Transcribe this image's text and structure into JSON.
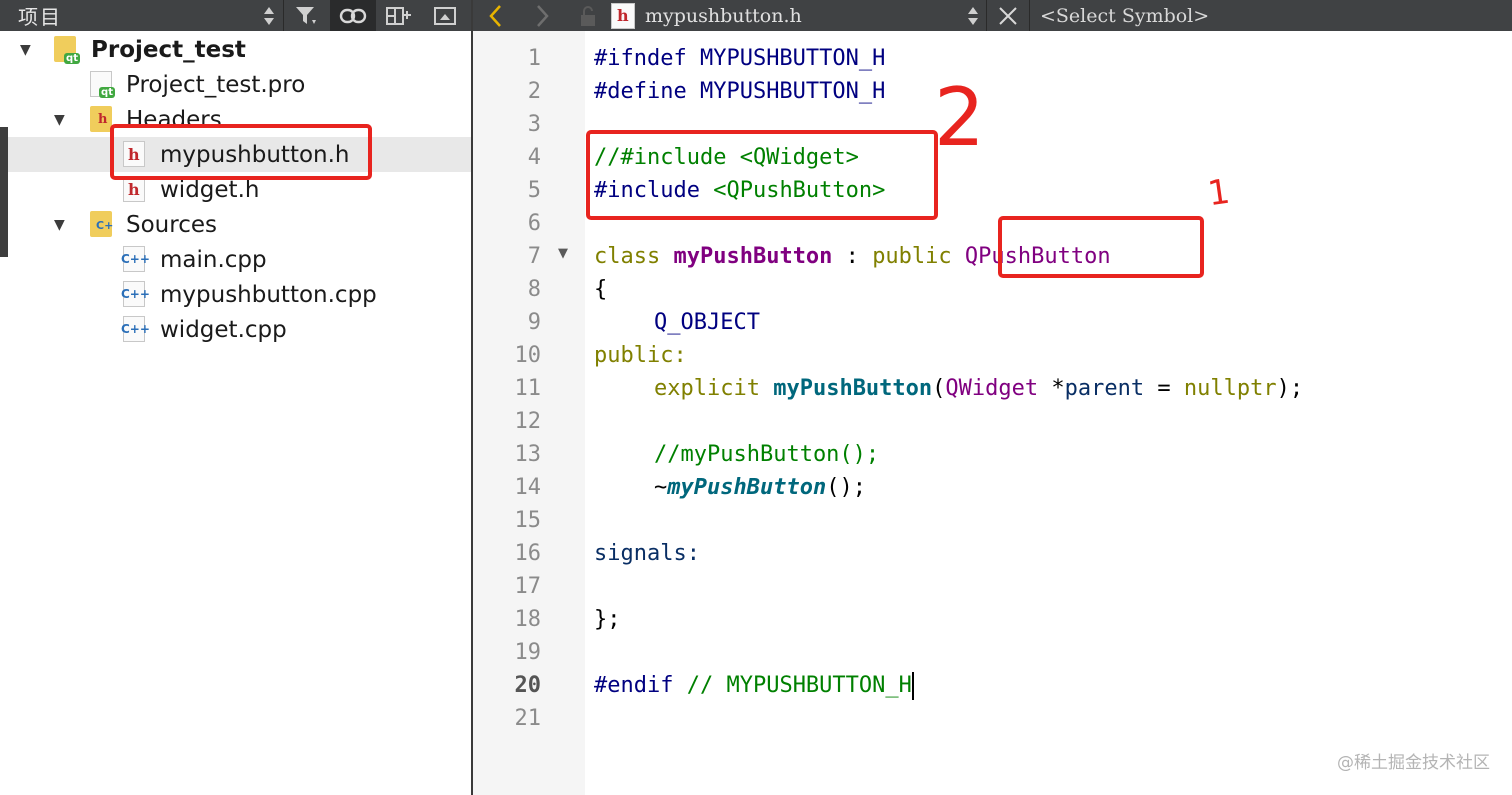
{
  "project_panel": {
    "title": "项目",
    "tree": [
      {
        "label": "Project_test",
        "type": "project"
      },
      {
        "label": "Project_test.pro",
        "type": "pro-file"
      },
      {
        "label": "Headers",
        "type": "folder-h"
      },
      {
        "label": "mypushbutton.h",
        "type": "header"
      },
      {
        "label": "widget.h",
        "type": "header"
      },
      {
        "label": "Sources",
        "type": "folder-cpp"
      },
      {
        "label": "main.cpp",
        "type": "source"
      },
      {
        "label": "mypushbutton.cpp",
        "type": "source"
      },
      {
        "label": "widget.cpp",
        "type": "source"
      }
    ],
    "icons": {
      "h": "h",
      "cpp": "C++",
      "qt": "qt",
      "cfolder": "C+"
    }
  },
  "editor_toolbar": {
    "filename": "mypushbutton.h",
    "symbol_placeholder": "<Select Symbol>"
  },
  "editor": {
    "line_numbers": [
      "1",
      "2",
      "3",
      "4",
      "5",
      "6",
      "7",
      "8",
      "9",
      "10",
      "11",
      "12",
      "13",
      "14",
      "15",
      "16",
      "17",
      "18",
      "19",
      "20",
      "21"
    ],
    "current_line": "20",
    "lines": {
      "l1a": "#ifndef",
      "l1b": " MYPUSHBUTTON_H",
      "l2a": "#define",
      "l2b": " MYPUSHBUTTON_H",
      "l4": "//#include <QWidget>",
      "l5a": "#include",
      "l5b": " <QPushButton>",
      "l7a": "class",
      "l7b": "myPushButton",
      "l7c": " : ",
      "l7d": "public",
      "l7e": "QPushButton",
      "l8": "{",
      "l9": "Q_OBJECT",
      "l10": "public:",
      "l11a": "explicit",
      "l11b": "myPushButton",
      "l11c": "(",
      "l11d": "QWidget",
      "l11e": " *",
      "l11f": "parent",
      "l11g": " = ",
      "l11h": "nullptr",
      "l11i": ");",
      "l13": "//myPushButton();",
      "l14a": "~",
      "l14b": "myPushButton",
      "l14c": "();",
      "l16": "signals:",
      "l18": "};",
      "l20a": "#endif",
      "l20b": " // MYPUSHBUTTON_H"
    }
  },
  "annotations": {
    "label_1": "1",
    "label_2": "2",
    "color": "#e8241f"
  },
  "watermark": "@稀土掘金技术社区"
}
